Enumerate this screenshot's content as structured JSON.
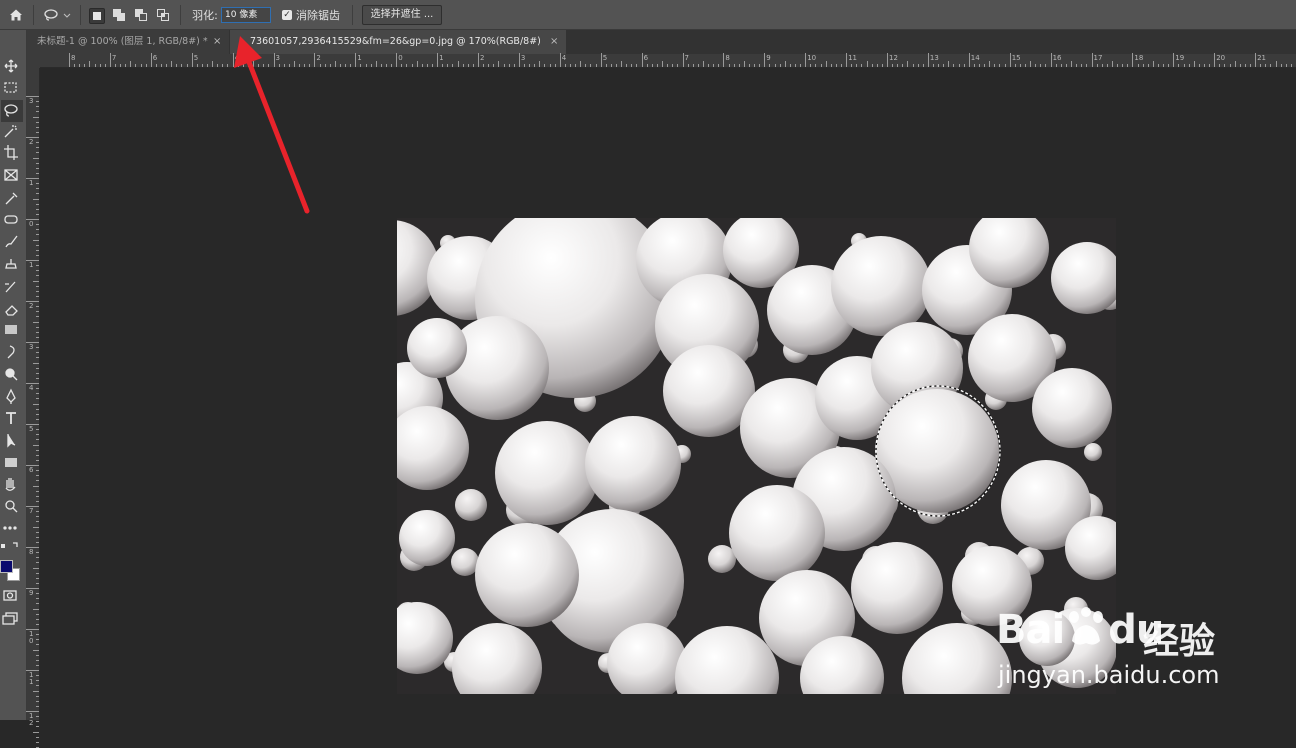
{
  "options_bar": {
    "feather_label": "羽化:",
    "feather_value": "10 像素",
    "antialias_label": "消除锯齿",
    "antialias_checked": "✓",
    "select_mask_label": "选择并遮住 ..."
  },
  "tabs": [
    {
      "label": "未标题-1 @ 100% (图层 1, RGB/8#) *",
      "close": "×"
    },
    {
      "label": "73601057,2936415529&fm=26&gp=0.jpg @ 170%(RGB/8#)",
      "close": "×"
    }
  ],
  "ruler": {
    "h_labels": [
      "8",
      "7",
      "6",
      "5",
      "4",
      "3",
      "2",
      "1",
      "0",
      "1",
      "2",
      "3",
      "4",
      "5",
      "6",
      "7",
      "8",
      "9",
      "10",
      "11",
      "12",
      "13",
      "14",
      "15",
      "16",
      "17",
      "18",
      "19",
      "20",
      "21"
    ],
    "v_labels": [
      "3",
      "2",
      "1",
      "0",
      "1",
      "2",
      "3",
      "4",
      "5",
      "6",
      "7",
      "8",
      "9",
      "1\n0",
      "1\n1",
      "1\n2"
    ]
  },
  "toolbar": {
    "foreground_color": "#0a0a6e",
    "background_color": "#ffffff",
    "tools": [
      "move-icon",
      "marquee-icon",
      "lasso-icon",
      "magic-wand-icon",
      "crop-icon",
      "frame-icon",
      "eyedropper-icon",
      "healing-icon",
      "brush-icon",
      "stamp-icon",
      "history-brush-icon",
      "eraser-icon",
      "gradient-icon",
      "blur-icon",
      "dodge-icon",
      "pen-icon",
      "type-icon",
      "path-select-icon",
      "rectangle-icon",
      "hand-icon",
      "zoom-icon",
      "more-icon"
    ]
  },
  "watermark": {
    "logo": "Bai",
    "logo_tail": "du",
    "cn": "经验",
    "url": "jingyan.baidu.com"
  },
  "colors": {
    "annotation_arrow": "#e8232b",
    "selection_focus": "#2f6fb2"
  }
}
